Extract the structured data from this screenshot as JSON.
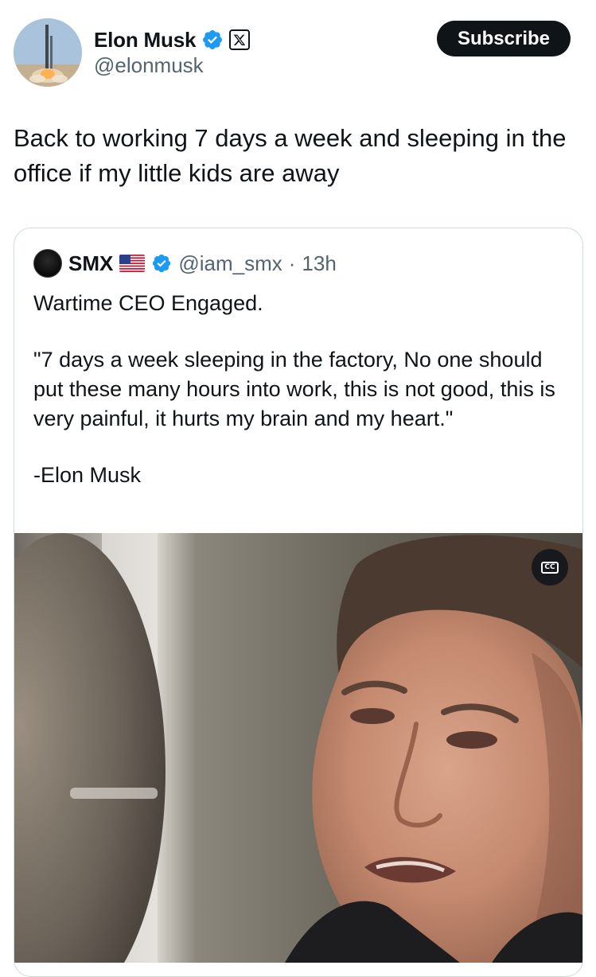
{
  "author": {
    "display_name": "Elon Musk",
    "handle": "@elonmusk",
    "avatar_icon": "rocket-launch-avatar",
    "verified_icon": "verified-badge-icon",
    "affiliation_icon": "x-logo-icon"
  },
  "header": {
    "subscribe_label": "Subscribe"
  },
  "tweet": {
    "text": "Back to working 7 days a week and sleeping in the office if my little kids are away"
  },
  "quote": {
    "display_name": "SMX",
    "flag_icon": "us-flag-icon",
    "verified_icon": "verified-badge-icon",
    "handle": "@iam_smx",
    "separator": "·",
    "time": "13h",
    "line1": "Wartime CEO Engaged.",
    "line2": "\"7 days a week sleeping in the factory, No one should put these many hours into work, this is not good, this is very painful, it hurts my brain and my heart.\"",
    "line3": "-Elon Musk"
  },
  "media": {
    "cc_label": "CC"
  },
  "colors": {
    "text_primary": "#0f1419",
    "text_secondary": "#536471",
    "verified_blue": "#1d9bf0",
    "border": "#cfd9de",
    "button_bg": "#0f1419"
  }
}
